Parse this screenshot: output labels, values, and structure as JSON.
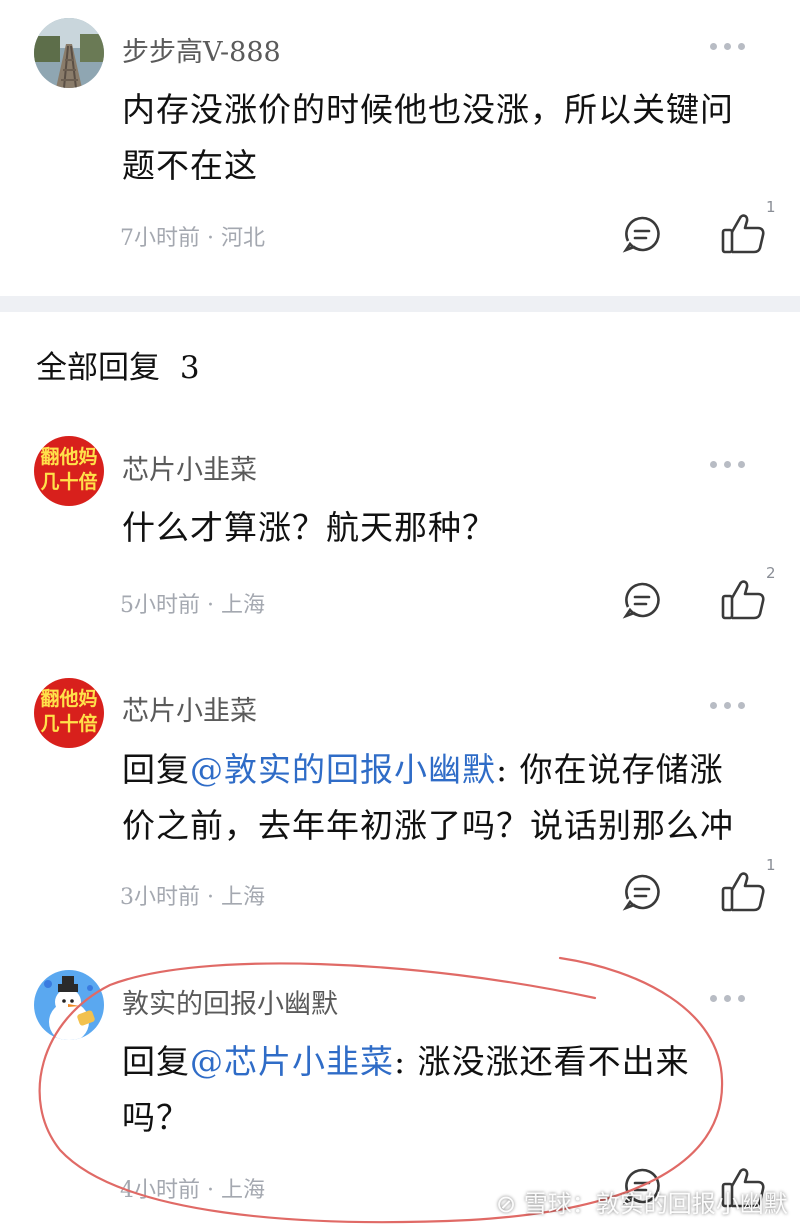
{
  "top_comment": {
    "username": "步步高V-888",
    "text": "内存没涨价的时候他也没涨，所以关键问题不在这",
    "time": "7小时前",
    "location": "河北",
    "likes": "1"
  },
  "replies_header": {
    "label": "全部回复",
    "count": "3"
  },
  "replies": [
    {
      "username": "芯片小韭菜",
      "avatar_text": [
        "翻他妈",
        "几十倍"
      ],
      "prefix": "",
      "mention": "",
      "text": "什么才算涨？航天那种？",
      "time": "5小时前",
      "location": "上海",
      "likes": "2"
    },
    {
      "username": "芯片小韭菜",
      "avatar_text": [
        "翻他妈",
        "几十倍"
      ],
      "prefix": "回复",
      "mention": "@敦实的回报小幽默",
      "text": ": 你在说存储涨价之前，去年年初涨了吗？说话别那么冲",
      "time": "3小时前",
      "location": "上海",
      "likes": "1"
    },
    {
      "username": "敦实的回报小幽默",
      "prefix": "回复",
      "mention": "@芯片小韭菜",
      "text": ": 涨没涨还看不出来吗？",
      "time": "4小时前",
      "location": "上海",
      "likes": ""
    }
  ],
  "watermark": "雪球：敦实的回报小幽默",
  "colors": {
    "mention": "#2f6cc7",
    "annotation_circle": "#e06a66",
    "avatar_red": "#d8201c",
    "avatar_text_yellow": "#ffe14a"
  },
  "icons": [
    "more-icon",
    "comment-reply-icon",
    "thumbs-up-icon"
  ]
}
